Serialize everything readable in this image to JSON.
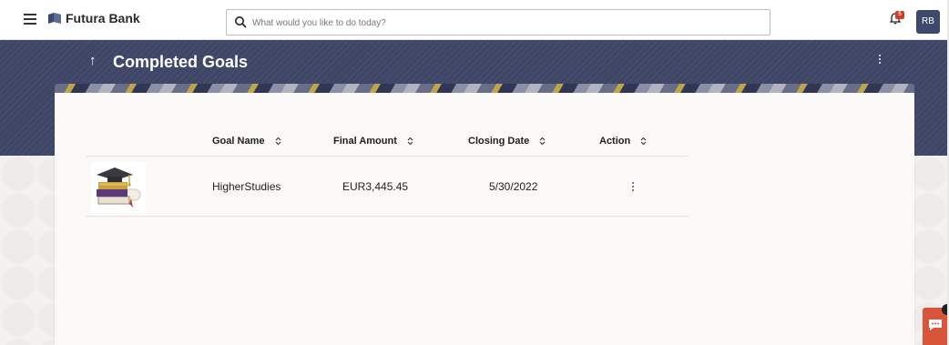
{
  "app": {
    "brand": "Futura Bank",
    "avatar_initials": "RB",
    "notification_count": "5"
  },
  "search": {
    "placeholder": "What would you like to do today?"
  },
  "page": {
    "title": "Completed Goals"
  },
  "table": {
    "columns": [
      {
        "label": "Goal Name"
      },
      {
        "label": "Final Amount"
      },
      {
        "label": "Closing Date"
      },
      {
        "label": "Action"
      }
    ],
    "rows": [
      {
        "goal_name": "HigherStudies",
        "final_amount": "EUR3,445.45",
        "closing_date": "5/30/2022",
        "image_icon": "graduation-books-icon"
      }
    ]
  },
  "colors": {
    "header_band": "#3f4565",
    "accent_chat": "#d9553a",
    "avatar_bg": "#3e4a6b",
    "badge": "#d9382b"
  }
}
